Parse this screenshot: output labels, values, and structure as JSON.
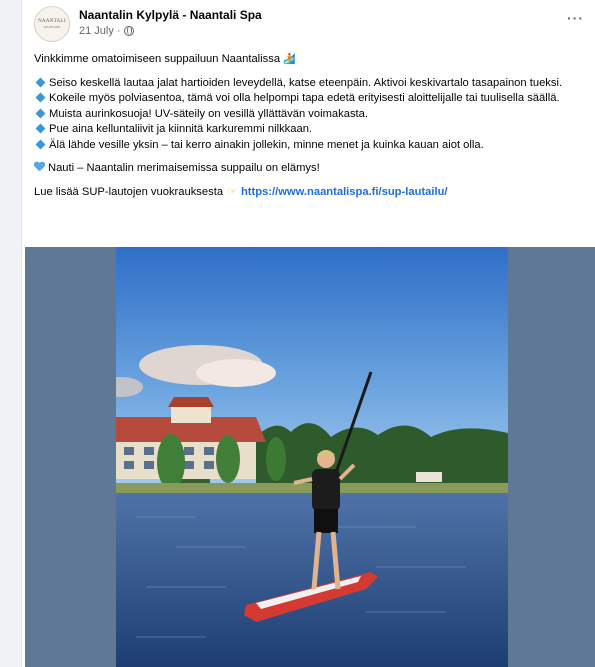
{
  "post": {
    "page_name": "Naantalin Kylpylä - Naantali Spa",
    "date": "21 July",
    "separator": "·",
    "more_label": "···",
    "avatar": {
      "logo_text": "NAANTALI",
      "logo_sub": "SPA RESORT"
    },
    "intro": "Vinkkimme omatoimiseen suppailuun Naantalissa",
    "intro_emoji": "🏄",
    "tips": [
      "Seiso keskellä lautaa jalat hartioiden leveydellä, katse eteenpäin. Aktivoi keskivartalo tasapainon tueksi.",
      "Kokeile myös polviasentoa, tämä voi olla helpompi tapa edetä erityisesti aloittelijalle tai tuulisella säällä.",
      "Muista aurinkosuoja! UV-säteily on vesillä yllättävän voimakasta.",
      "Pue aina kelluntaliivit ja kiinnitä karkuremmi nilkkaan.",
      "Älä lähde vesille yksin – tai kerro ainakin jollekin, minne menet ja kuinka kauan aiot olla."
    ],
    "closing": "Nauti – Naantalin merimaisemissa suppailu on elämys!",
    "more_info": "Lue lisää SUP-lautojen vuokrauksesta",
    "link_text": "https://www.naantalispa.fi/sup-lautailu/"
  },
  "icons": {
    "globe": "globe-icon",
    "more": "more-options-icon",
    "bullet": "blue-diamond-icon",
    "heart": "blue-heart-icon",
    "pointer": "pointing-hand-icon"
  },
  "colors": {
    "link": "#216fdb",
    "bullet": "#3b97d8",
    "photo_frame": "#5e7896",
    "meta_text": "#65676b"
  }
}
